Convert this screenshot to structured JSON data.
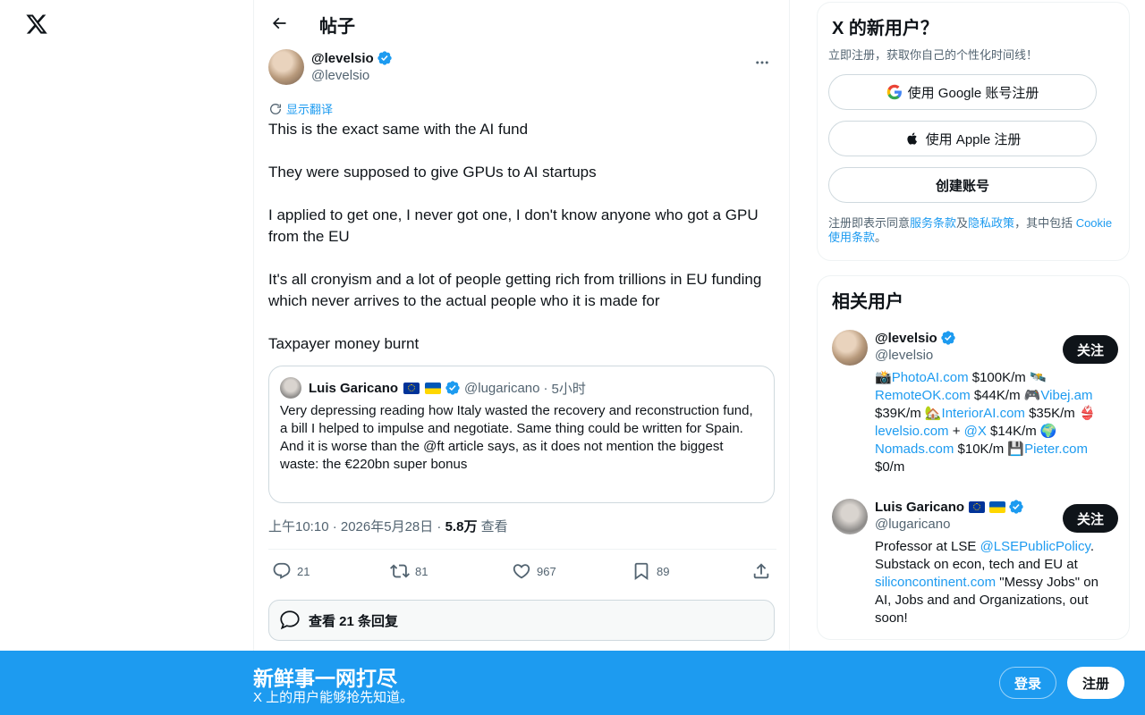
{
  "colors": {
    "accent": "#1d9bf0",
    "text": "#0f1419",
    "muted": "#536471",
    "border": "#cfd9de"
  },
  "nav": {
    "logo_icon": "x-logo-icon"
  },
  "header": {
    "back_icon": "arrow-left-icon",
    "title": "帖子"
  },
  "post": {
    "author_name": "@levelsio",
    "author_handle": "@levelsio",
    "verified": true,
    "more_icon": "more-horizontal-icon",
    "translate_label": "显示翻译",
    "paragraphs": [
      "This is the exact same with the AI fund",
      "They were supposed to give GPUs to AI startups",
      "I applied to get one, I never got one, I don't know anyone who got a GPU from the EU",
      "It's all cronyism and a lot of people getting rich from trillions in EU funding which never arrives to the actual people who it is made for",
      "Taxpayer money burnt"
    ],
    "quote": {
      "name": "Luis Garicano",
      "flags": [
        "eu-flag",
        "ukraine-flag"
      ],
      "verified": true,
      "handle": "@lugaricano",
      "separator": "·",
      "time": "5小时",
      "line1": "Very depressing reading how Italy wasted the recovery and reconstruction fund, a bill I helped to impulse and negotiate.  Same thing could be written for Spain.",
      "line2": "And it is worse than the @ft article says, as it does not mention the biggest waste: the €220bn super bonus"
    },
    "timestamp": "上午10:10 · 2026年5月28日 · ",
    "views_count": "5.8万",
    "views_label": "查看",
    "actions": {
      "replies": "21",
      "reposts": "81",
      "likes": "967",
      "bookmarks": "89"
    },
    "view_replies": "查看 21 条回复"
  },
  "signup": {
    "title": "X 的新用户？",
    "subtitle": "立即注册，获取你自己的个性化时间线！",
    "google": "使用 Google 账号注册",
    "apple": "使用 Apple 注册",
    "create": "创建账号",
    "terms_prefix": "注册即表示同意",
    "terms_link": "服务条款",
    "terms_and": "及",
    "privacy_link": "隐私政策",
    "terms_mid": "，其中包括 ",
    "cookie_link": "Cookie 使用条款",
    "terms_end": "。"
  },
  "related": {
    "title": "相关用户",
    "users": [
      {
        "name": "@levelsio",
        "handle": "@levelsio",
        "follow": "关注",
        "bio": [
          {
            "t": "📸"
          },
          {
            "l": "PhotoAI.com"
          },
          {
            "t": " $100K/m 🛰️ "
          },
          {
            "l": "RemoteOK.com"
          },
          {
            "t": " $44K/m 🎮"
          },
          {
            "l": "Vibej.am"
          },
          {
            "t": " $39K/m 🏡"
          },
          {
            "l": "InteriorAI.com"
          },
          {
            "t": " $35K/m 👙 "
          },
          {
            "l": "levelsio.com"
          },
          {
            "t": " + "
          },
          {
            "l": "@X"
          },
          {
            "t": " $14K/m 🌍 "
          },
          {
            "l": "Nomads.com"
          },
          {
            "t": " $10K/m 💾"
          },
          {
            "l": "Pieter.com"
          },
          {
            "t": " $0/m"
          }
        ]
      },
      {
        "name": "Luis Garicano",
        "handle": "@lugaricano",
        "follow": "关注",
        "bio": [
          {
            "t": "Professor at LSE "
          },
          {
            "l": "@LSEPublicPolicy"
          },
          {
            "t": ". Substack on econ, tech and EU at "
          },
          {
            "l": "siliconcontinent.com"
          },
          {
            "t": " \"Messy Jobs\" on AI, Jobs and and Organizations, out soon!"
          }
        ]
      }
    ]
  },
  "banner": {
    "title": "新鲜事一网打尽",
    "subtitle": "X 上的用户能够抢先知道。",
    "login": "登录",
    "signup": "注册"
  }
}
